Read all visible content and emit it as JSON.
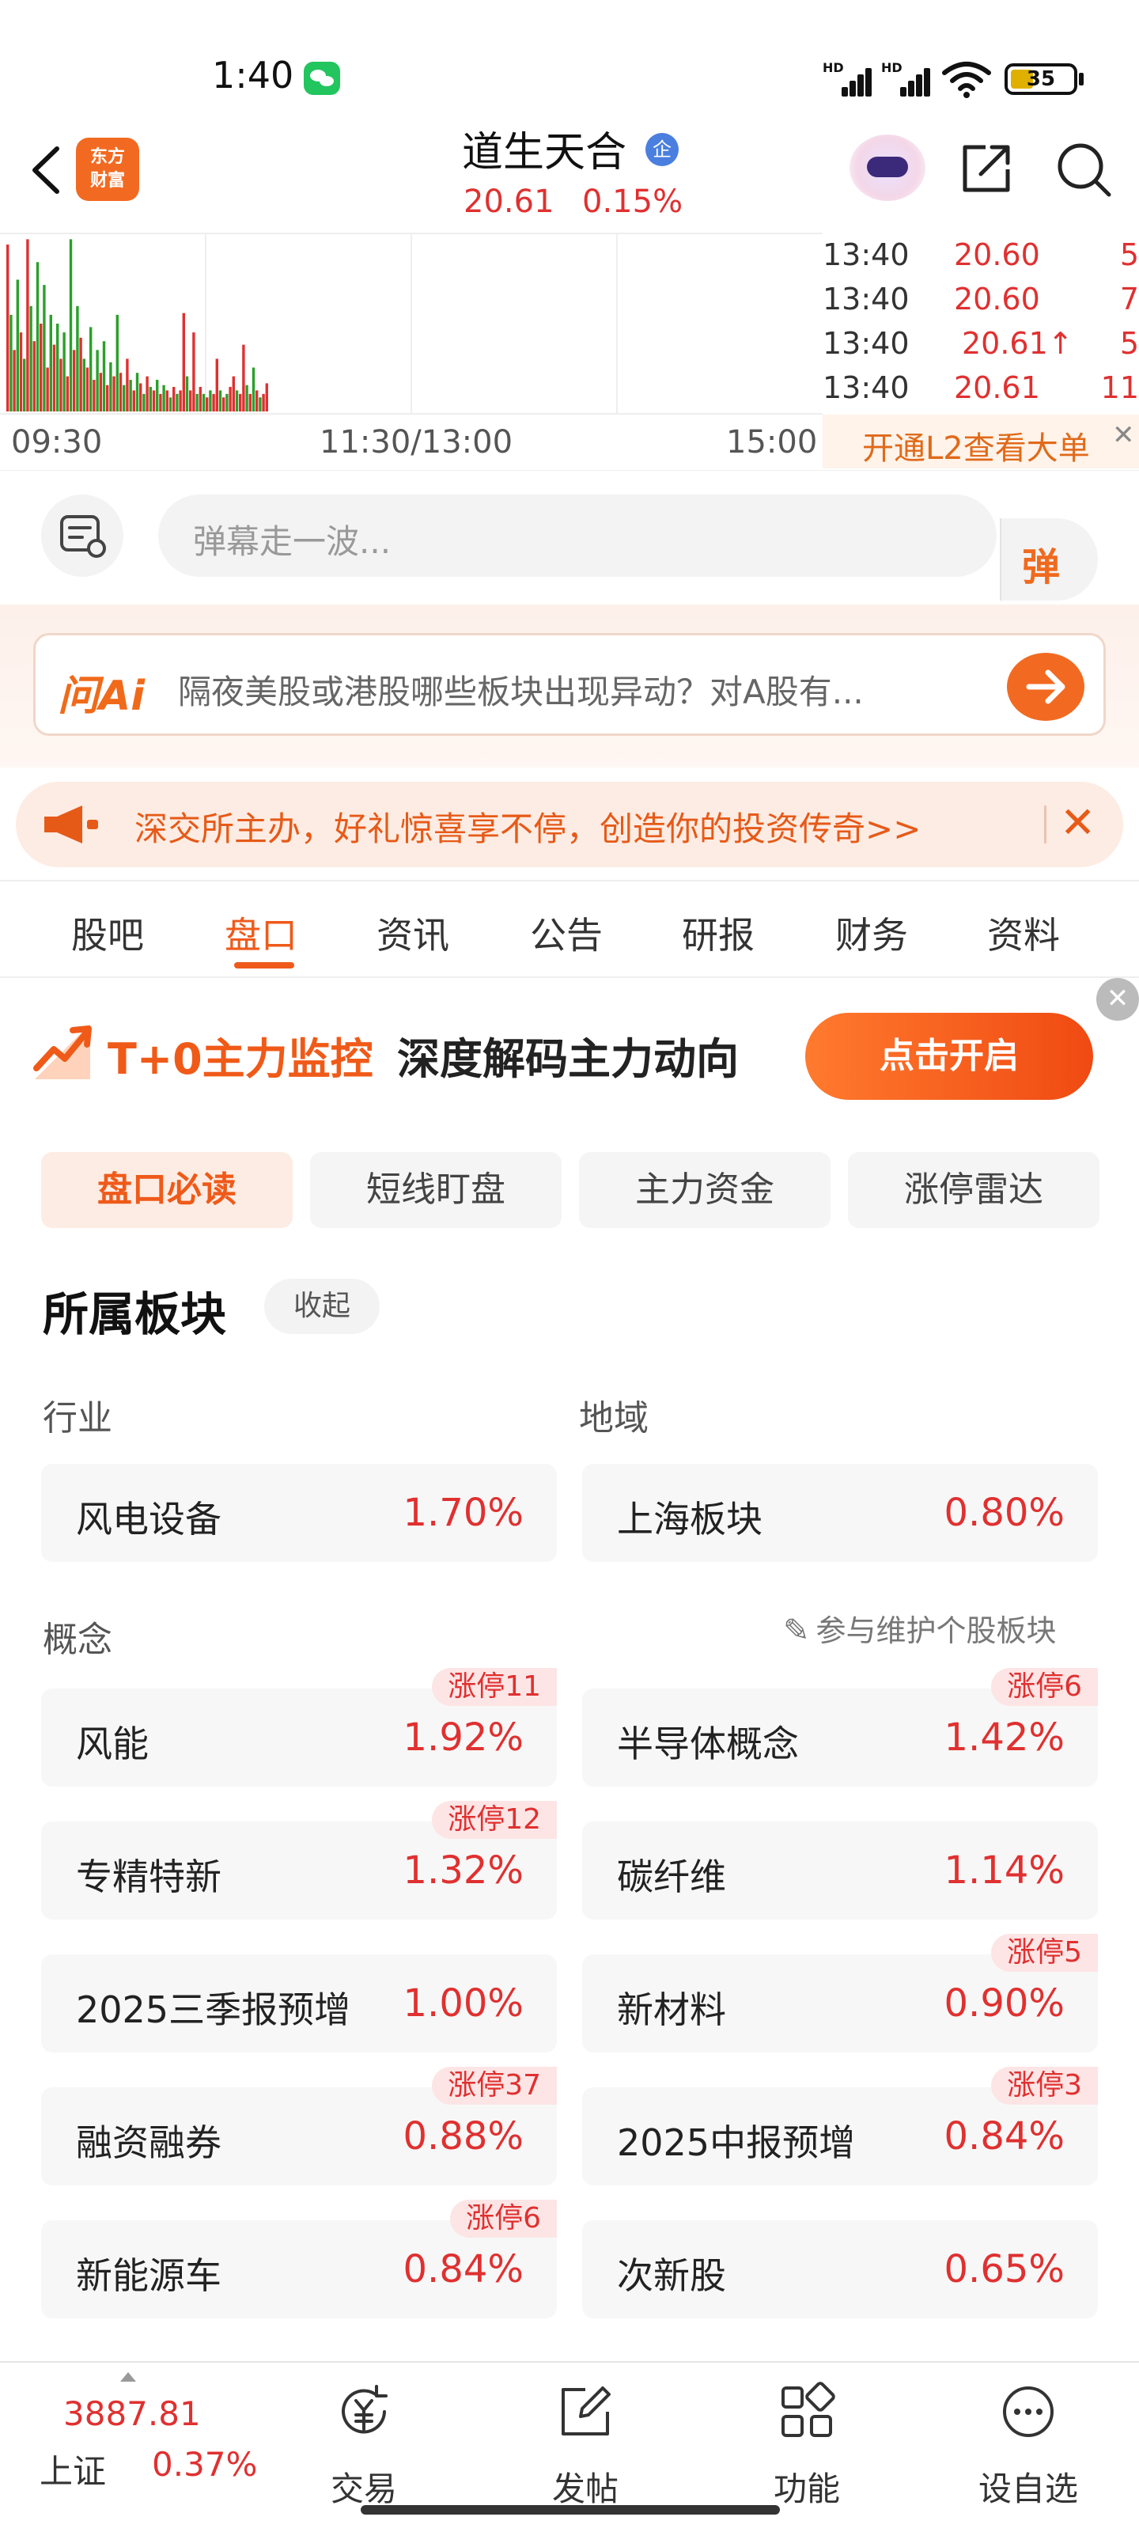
{
  "status_bar": {
    "time": "1:40",
    "battery": "35",
    "network": [
      "HD",
      "HD"
    ]
  },
  "header": {
    "logo_text": [
      "东方",
      "财富"
    ],
    "stock_name": "道生天合",
    "badge": "企",
    "price": "20.61",
    "change": "0.15%"
  },
  "intraday": {
    "axis_labels": [
      "09:30",
      "11:30/13:00",
      "15:00"
    ],
    "volume_bars": [
      {
        "v": 0.95,
        "up": true
      },
      {
        "v": 0.55,
        "up": false
      },
      {
        "v": 0.35,
        "up": true
      },
      {
        "v": 0.75,
        "up": false
      },
      {
        "v": 0.45,
        "up": true
      },
      {
        "v": 0.3,
        "up": false
      },
      {
        "v": 0.98,
        "up": true
      },
      {
        "v": 0.6,
        "up": false
      },
      {
        "v": 0.4,
        "up": true
      },
      {
        "v": 0.85,
        "up": false
      },
      {
        "v": 0.5,
        "up": true
      },
      {
        "v": 0.72,
        "up": false
      },
      {
        "v": 0.25,
        "up": true
      },
      {
        "v": 0.55,
        "up": false
      },
      {
        "v": 0.38,
        "up": true
      },
      {
        "v": 0.5,
        "up": false
      },
      {
        "v": 0.3,
        "up": true
      },
      {
        "v": 0.45,
        "up": false
      },
      {
        "v": 0.2,
        "up": true
      },
      {
        "v": 0.98,
        "up": false
      },
      {
        "v": 0.35,
        "up": true
      },
      {
        "v": 0.6,
        "up": false
      },
      {
        "v": 0.42,
        "up": true
      },
      {
        "v": 0.3,
        "up": false
      },
      {
        "v": 0.25,
        "up": true
      },
      {
        "v": 0.48,
        "up": false
      },
      {
        "v": 0.18,
        "up": true
      },
      {
        "v": 0.35,
        "up": false
      },
      {
        "v": 0.22,
        "up": true
      },
      {
        "v": 0.4,
        "up": false
      },
      {
        "v": 0.15,
        "up": true
      },
      {
        "v": 0.28,
        "up": false
      },
      {
        "v": 0.2,
        "up": true
      },
      {
        "v": 0.55,
        "up": false
      },
      {
        "v": 0.22,
        "up": true
      },
      {
        "v": 0.15,
        "up": false
      },
      {
        "v": 0.3,
        "up": true
      },
      {
        "v": 0.18,
        "up": false
      },
      {
        "v": 0.12,
        "up": true
      },
      {
        "v": 0.22,
        "up": false
      },
      {
        "v": 0.16,
        "up": true
      },
      {
        "v": 0.1,
        "up": false
      },
      {
        "v": 0.2,
        "up": true
      },
      {
        "v": 0.14,
        "up": false
      },
      {
        "v": 0.12,
        "up": true
      },
      {
        "v": 0.18,
        "up": false
      },
      {
        "v": 0.1,
        "up": true
      },
      {
        "v": 0.15,
        "up": false
      },
      {
        "v": 0.12,
        "up": true
      },
      {
        "v": 0.08,
        "up": false
      },
      {
        "v": 0.14,
        "up": true
      },
      {
        "v": 0.1,
        "up": false
      },
      {
        "v": 0.12,
        "up": true
      },
      {
        "v": 0.56,
        "up": true
      },
      {
        "v": 0.2,
        "up": false
      },
      {
        "v": 0.12,
        "up": true
      },
      {
        "v": 0.45,
        "up": true
      },
      {
        "v": 0.1,
        "up": false
      },
      {
        "v": 0.14,
        "up": true
      },
      {
        "v": 0.1,
        "up": false
      },
      {
        "v": 0.08,
        "up": true
      },
      {
        "v": 0.12,
        "up": false
      },
      {
        "v": 0.1,
        "up": true
      },
      {
        "v": 0.3,
        "up": true
      },
      {
        "v": 0.12,
        "up": false
      },
      {
        "v": 0.08,
        "up": true
      },
      {
        "v": 0.1,
        "up": false
      },
      {
        "v": 0.14,
        "up": true
      },
      {
        "v": 0.2,
        "up": true
      },
      {
        "v": 0.12,
        "up": false
      },
      {
        "v": 0.1,
        "up": true
      },
      {
        "v": 0.38,
        "up": true
      },
      {
        "v": 0.15,
        "up": false
      },
      {
        "v": 0.1,
        "up": true
      },
      {
        "v": 0.25,
        "up": false
      },
      {
        "v": 0.12,
        "up": true
      },
      {
        "v": 0.08,
        "up": false
      },
      {
        "v": 0.1,
        "up": true
      },
      {
        "v": 0.16,
        "up": true
      }
    ],
    "ticks": [
      {
        "time": "13:40",
        "price": "20.60",
        "vol": "5",
        "arrow": ""
      },
      {
        "time": "13:40",
        "price": "20.60",
        "vol": "7",
        "arrow": ""
      },
      {
        "time": "13:40",
        "price": "20.61",
        "vol": "5",
        "arrow": "↑"
      },
      {
        "time": "13:40",
        "price": "20.61",
        "vol": "11",
        "arrow": ""
      }
    ],
    "l2_banner": "开通L2查看大单",
    "l2_close": "✕"
  },
  "danmu": {
    "placeholder": "弹幕走一波...",
    "button": "弹"
  },
  "ai": {
    "logo": "问Ai",
    "question": "隔夜美股或港股哪些板块出现异动？对A股有..."
  },
  "promo": {
    "text": "深交所主办，好礼惊喜享不停，创造你的投资传奇>>",
    "close": "✕"
  },
  "tabs": [
    "股吧",
    "盘口",
    "资讯",
    "公告",
    "研报",
    "财务",
    "资料"
  ],
  "active_tab": 1,
  "t0_banner": {
    "title_highlight": "T+0主力监控",
    "title_rest": "深度解码主力动向",
    "button": "点击开启",
    "close": "✕"
  },
  "subtabs": [
    "盘口必读",
    "短线盯盘",
    "主力资金",
    "涨停雷达"
  ],
  "sectors": {
    "title": "所属板块",
    "collapse": "收起",
    "industry_label": "行业",
    "region_label": "地域",
    "industry": {
      "name": "风电设备",
      "pct": "1.70%"
    },
    "region": {
      "name": "上海板块",
      "pct": "0.80%"
    },
    "concept_label": "概念",
    "maintain": "参与维护个股板块",
    "concepts": [
      {
        "name": "风能",
        "pct": "1.92%",
        "badge": "涨停11"
      },
      {
        "name": "半导体概念",
        "pct": "1.42%",
        "badge": "涨停6"
      },
      {
        "name": "专精特新",
        "pct": "1.32%",
        "badge": "涨停12"
      },
      {
        "name": "碳纤维",
        "pct": "1.14%",
        "badge": ""
      },
      {
        "name": "2025三季报预增",
        "pct": "1.00%",
        "badge": ""
      },
      {
        "name": "新材料",
        "pct": "0.90%",
        "badge": "涨停5"
      },
      {
        "name": "融资融券",
        "pct": "0.88%",
        "badge": "涨停37"
      },
      {
        "name": "2025中报预增",
        "pct": "0.84%",
        "badge": "涨停3"
      },
      {
        "name": "新能源车",
        "pct": "0.84%",
        "badge": "涨停6"
      },
      {
        "name": "次新股",
        "pct": "0.65%",
        "badge": ""
      }
    ]
  },
  "bottom_bar": {
    "index_value": "3887.81",
    "index_name": "上证",
    "index_change": "0.37%",
    "items": [
      {
        "label": "交易",
        "icon": "yuan-refresh-icon"
      },
      {
        "label": "发帖",
        "icon": "edit-icon"
      },
      {
        "label": "功能",
        "icon": "grid-icon"
      },
      {
        "label": "设自选",
        "icon": "more-icon"
      }
    ]
  },
  "colors": {
    "accent": "#ef5a1a",
    "up": "#e03030",
    "down": "#2aa02a"
  }
}
